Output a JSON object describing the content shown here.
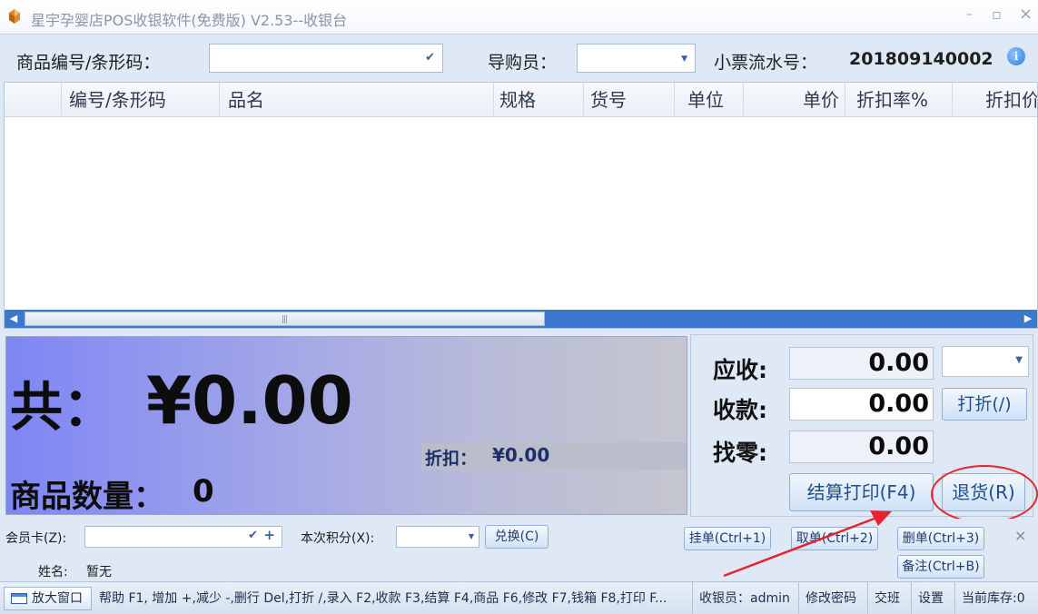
{
  "window": {
    "title": "星宇孕婴店POS收银软件(免费版) V2.53--收银台",
    "minimize_glyph": "–",
    "maximize_glyph": "▫",
    "close_glyph": "×"
  },
  "search_row": {
    "barcode_label": "商品编号/条形码：",
    "barcode_value": "",
    "guide_label": "导购员：",
    "guide_value": "",
    "receipt_label": "小票流水号：",
    "receipt_number": "201809140002",
    "info_glyph": "i"
  },
  "grid": {
    "columns": [
      "",
      "编号/条形码",
      "品名",
      "规格",
      "货号",
      "单位",
      "单价",
      "折扣率%",
      "折扣价"
    ],
    "rows": [],
    "scroll_left_glyph": "◀",
    "scroll_right_glyph": "▶",
    "scroll_grip_glyph": "|||"
  },
  "totals": {
    "total_label": "共：",
    "total_amount": "¥0.00",
    "quantity_label": "商品数量：",
    "quantity_value": "0",
    "discount_label": "折扣：",
    "discount_amount": "¥0.00"
  },
  "payment": {
    "receivable_label": "应收:",
    "receivable_value": "0.00",
    "received_label": "收款:",
    "received_value": "0.00",
    "change_label": "找零:",
    "change_value": "0.00",
    "payment_method_value": "",
    "discount_button": "打折(/)",
    "checkout_button": "结算打印(F4)",
    "return_button": "退货(R)"
  },
  "member": {
    "card_label": "会员卡(Z):",
    "card_value": "",
    "card_add_glyph": "+",
    "points_label": "本次积分(X):",
    "points_value": "",
    "exchange_button": "兑换(C)",
    "name_label": "姓名:",
    "name_value": "暂无",
    "hold_button": "挂单(Ctrl+1)",
    "retrieve_button": "取单(Ctrl+2)",
    "delete_button": "删单(Ctrl+3)",
    "note_button": "备注(Ctrl+B)",
    "close_glyph": "×"
  },
  "status_bar": {
    "enlarge_button": "放大窗口",
    "shortcuts": "帮助 F1, 增加 +,减少 -,删行 Del,打折 /,录入 F2,收款 F3,结算 F4,商品 F6,修改 F7,钱箱 F8,打印 F...",
    "cashier": "收银员：admin",
    "change_password": "修改密码",
    "shift": "交班",
    "settings": "设置",
    "stock": "当前库存:0"
  },
  "colors": {
    "annotation": "#e8232a",
    "scrollbar": "#3d78d0",
    "discount_text": "#1d2f6b"
  }
}
